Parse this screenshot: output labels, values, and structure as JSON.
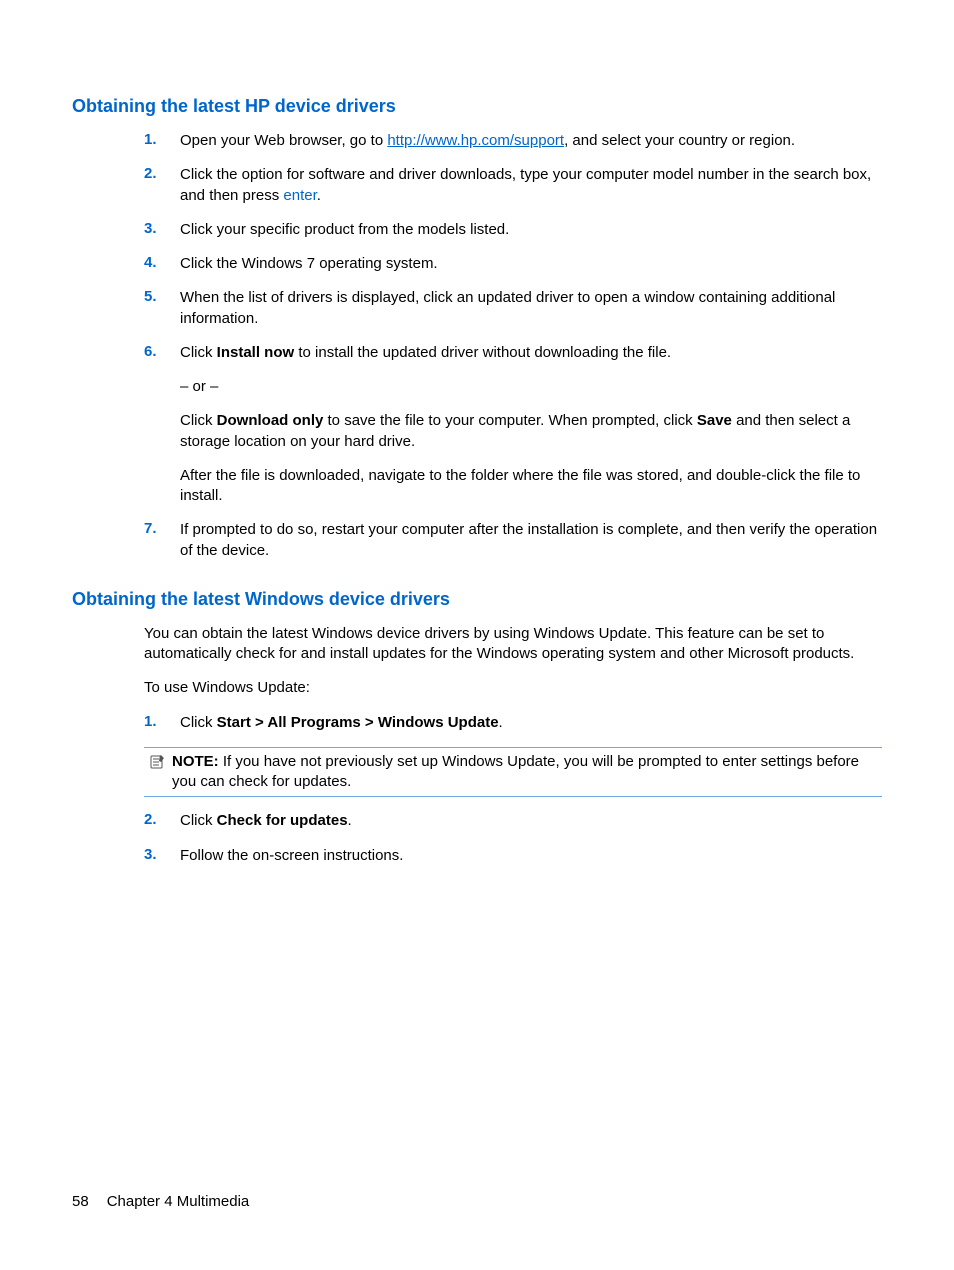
{
  "section1": {
    "heading": "Obtaining the latest HP device drivers",
    "steps": {
      "s1": {
        "num": "1.",
        "pre": "Open your Web browser, go to ",
        "link": "http://www.hp.com/support",
        "post": ", and select your country or region."
      },
      "s2": {
        "num": "2.",
        "pre": "Click the option for software and driver downloads, type your computer model number in the search box, and then press ",
        "kw": "enter",
        "post": "."
      },
      "s3": {
        "num": "3.",
        "text": "Click your specific product from the models listed."
      },
      "s4": {
        "num": "4.",
        "text": "Click the Windows 7 operating system."
      },
      "s5": {
        "num": "5.",
        "text": "When the list of drivers is displayed, click an updated driver to open a window containing additional information."
      },
      "s6": {
        "num": "6.",
        "p1_pre": "Click ",
        "p1_b": "Install now",
        "p1_post": " to install the updated driver without downloading the file.",
        "or": "– or –",
        "p2_pre": "Click ",
        "p2_b1": "Download only",
        "p2_mid": " to save the file to your computer. When prompted, click ",
        "p2_b2": "Save",
        "p2_post": " and then select a storage location on your hard drive.",
        "p3": "After the file is downloaded, navigate to the folder where the file was stored, and double-click the file to install."
      },
      "s7": {
        "num": "7.",
        "text": "If prompted to do so, restart your computer after the installation is complete, and then verify the operation of the device."
      }
    }
  },
  "section2": {
    "heading": "Obtaining the latest Windows device drivers",
    "intro1": "You can obtain the latest Windows device drivers by using Windows Update. This feature can be set to automatically check for and install updates for the Windows operating system and other Microsoft products.",
    "intro2": "To use Windows Update:",
    "steps": {
      "s1": {
        "num": "1.",
        "pre": "Click ",
        "b": "Start > All Programs > Windows Update",
        "post": "."
      },
      "note": {
        "label": "NOTE:",
        "text": "   If you have not previously set up Windows Update, you will be prompted to enter settings before you can check for updates."
      },
      "s2": {
        "num": "2.",
        "pre": "Click ",
        "b": "Check for updates",
        "post": "."
      },
      "s3": {
        "num": "3.",
        "text": "Follow the on-screen instructions."
      }
    }
  },
  "footer": {
    "page": "58",
    "chapter": "Chapter 4   Multimedia"
  }
}
